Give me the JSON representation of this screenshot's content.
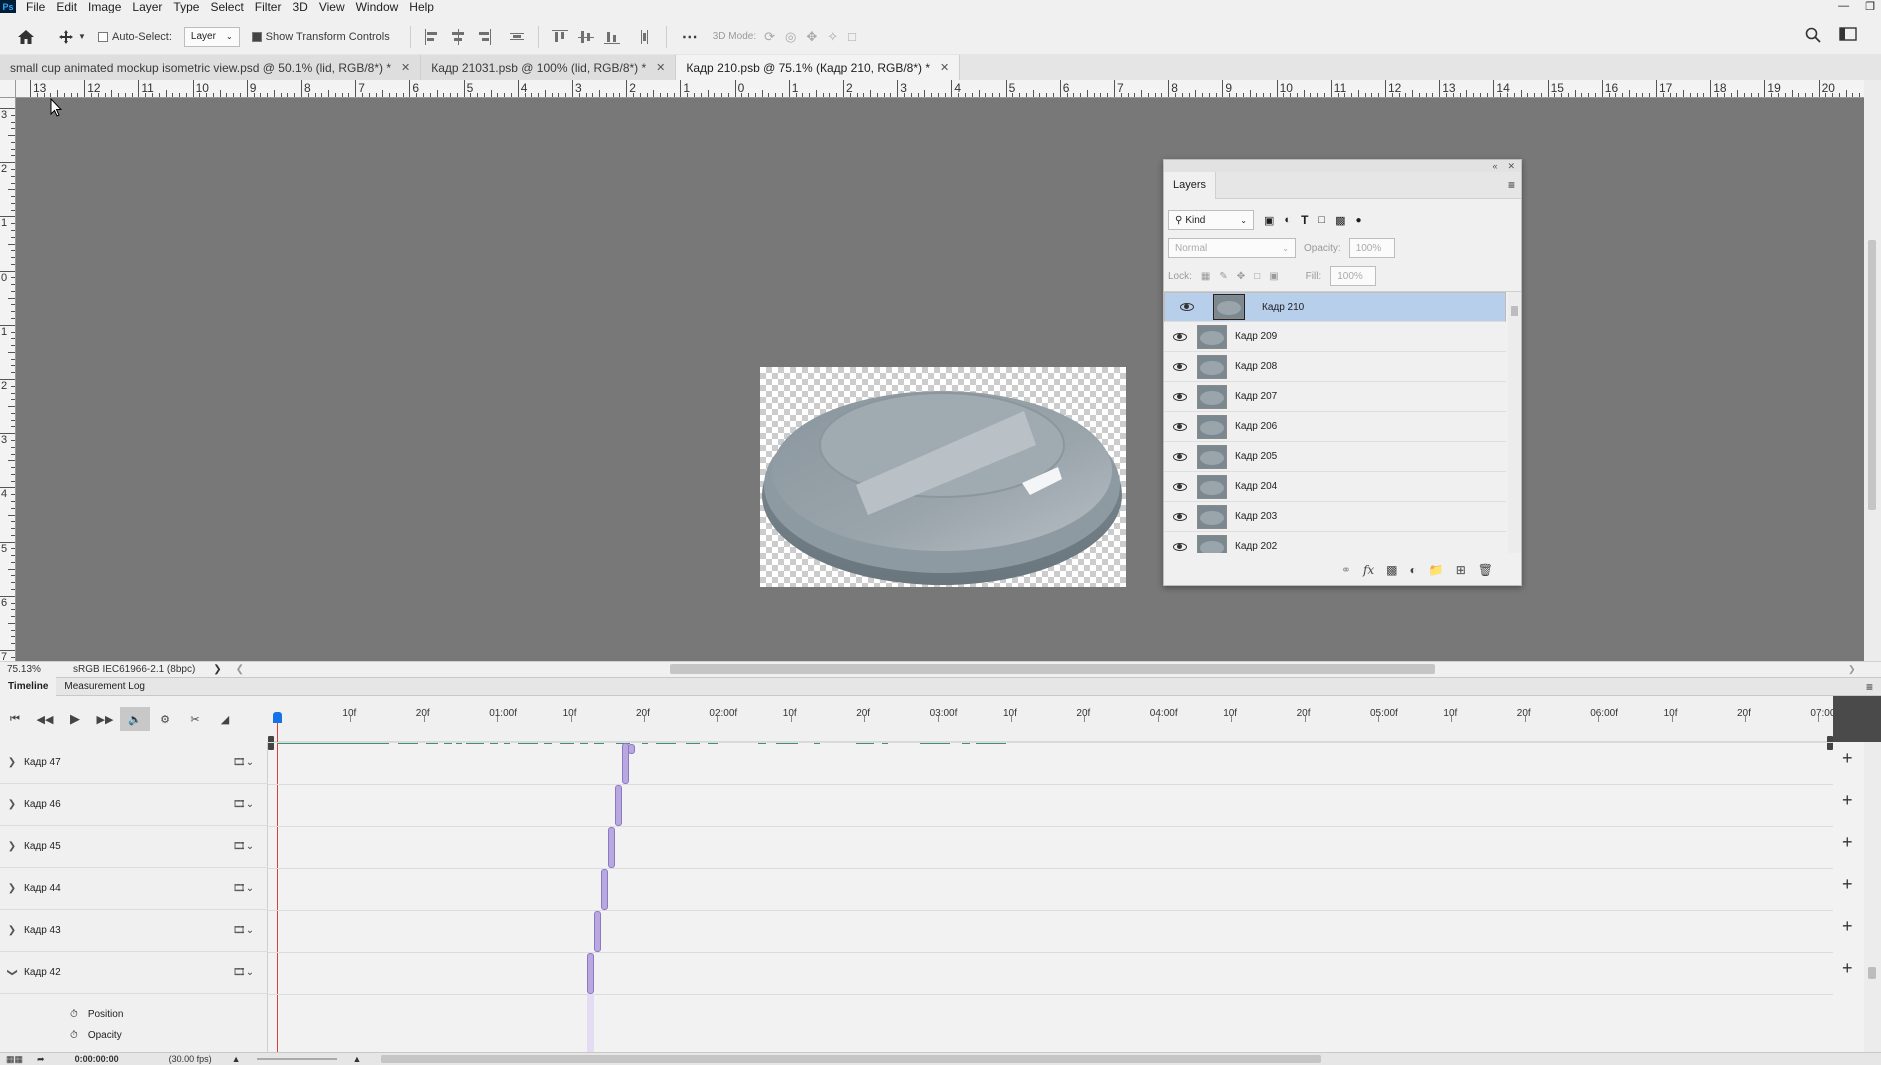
{
  "menubar": {
    "logo": "Ps",
    "items": [
      "File",
      "Edit",
      "Image",
      "Layer",
      "Type",
      "Select",
      "Filter",
      "3D",
      "View",
      "Window",
      "Help"
    ]
  },
  "options": {
    "auto_select_label": "Auto-Select:",
    "auto_select_checked": false,
    "target_select": "Layer",
    "show_transform_label": "Show Transform Controls",
    "show_transform_checked": true,
    "mode3d_label": "3D Mode:"
  },
  "tabs": [
    {
      "label": "small cup animated mockup isometric view.psd @ 50.1% (lid, RGB/8*) *",
      "active": false
    },
    {
      "label": "Кадр 21031.psb @ 100% (lid, RGB/8*) *",
      "active": false
    },
    {
      "label": "Кадр 210.psb @ 75.1% (Кадр 210, RGB/8*) *",
      "active": true
    }
  ],
  "ruler": {
    "h_labels": [
      "13",
      "12",
      "11",
      "10",
      "9",
      "8",
      "7",
      "6",
      "5",
      "4",
      "3",
      "2",
      "1",
      "0",
      "1",
      "2",
      "3",
      "4",
      "5",
      "6",
      "7",
      "8",
      "9",
      "10",
      "11",
      "12",
      "13",
      "14",
      "15",
      "16",
      "17",
      "18",
      "19",
      "20"
    ],
    "v_labels": [
      "3",
      "2",
      "1",
      "0",
      "1",
      "2",
      "3",
      "4",
      "5",
      "6",
      "7"
    ]
  },
  "status": {
    "zoom": "75.13%",
    "profile": "sRGB IEC61966-2.1 (8bpc)"
  },
  "layers_panel": {
    "tab": "Layers",
    "filter_kind": "Kind",
    "blend_mode": "Normal",
    "opacity_label": "Opacity:",
    "opacity_value": "100%",
    "lock_label": "Lock:",
    "fill_label": "Fill:",
    "fill_value": "100%",
    "layers": [
      {
        "name": "Кадр 210",
        "selected": true
      },
      {
        "name": "Кадр 209",
        "selected": false
      },
      {
        "name": "Кадр 208",
        "selected": false
      },
      {
        "name": "Кадр 207",
        "selected": false
      },
      {
        "name": "Кадр 206",
        "selected": false
      },
      {
        "name": "Кадр 205",
        "selected": false
      },
      {
        "name": "Кадр 204",
        "selected": false
      },
      {
        "name": "Кадр 203",
        "selected": false
      },
      {
        "name": "Кадр 202",
        "selected": false
      }
    ]
  },
  "timeline": {
    "tabs": [
      "Timeline",
      "Measurement Log"
    ],
    "ruler_labels": [
      "10f",
      "20f",
      "01:00f",
      "10f",
      "20f",
      "02:00f",
      "10f",
      "20f",
      "03:00f",
      "10f",
      "20f",
      "04:00f",
      "10f",
      "20f",
      "05:00f",
      "10f",
      "20f",
      "06:00f",
      "10f",
      "20f",
      "07:00f"
    ],
    "tracks": [
      "Кадр 47",
      "Кадр 46",
      "Кадр 45",
      "Кадр 44",
      "Кадр 43",
      "Кадр 42"
    ],
    "subtracks": [
      "Position",
      "Opacity"
    ],
    "current_time": "0:00:00:00",
    "fps": "(30.00 fps)"
  },
  "colors": {
    "accent_blue": "#1473e6",
    "layer_selected": "#b8cfeb",
    "clip_purple": "#b9a8e0",
    "playhead_red": "#e03a3a"
  }
}
